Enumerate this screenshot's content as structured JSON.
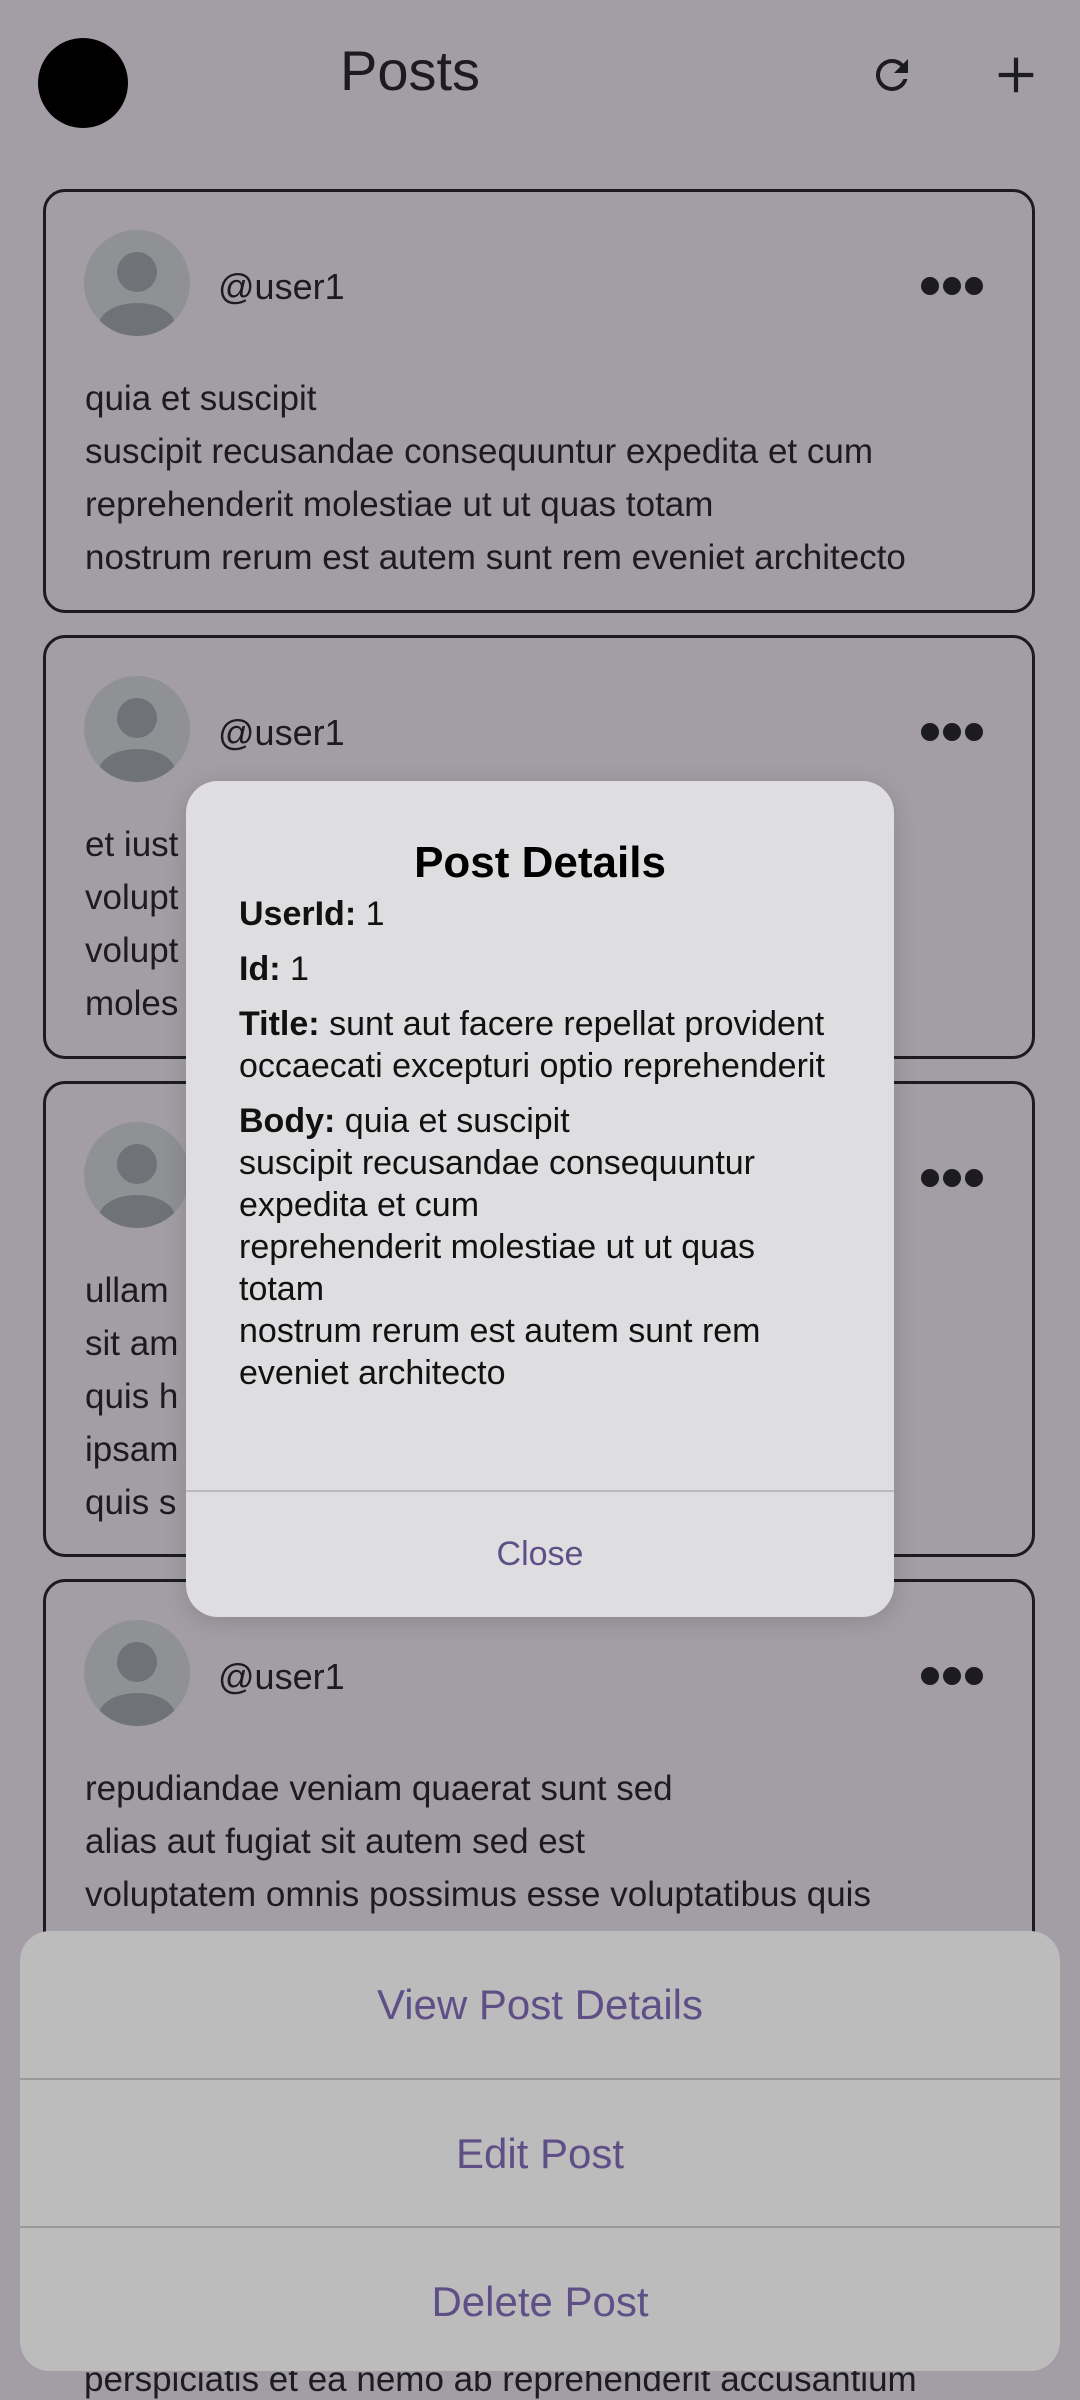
{
  "app_bar": {
    "title": "Posts",
    "icons": {
      "refresh": "refresh-icon",
      "add": "add-icon"
    }
  },
  "posts": [
    {
      "username": "@user1",
      "body": "quia et suscipit\nsuscipit recusandae consequuntur expedita et cum\nreprehenderit molestiae ut ut quas totam\nnostrum rerum est autem sunt rem eveniet architecto"
    },
    {
      "username": "@user1",
      "body": "et iust\nvolupt\nvolupt                                                                   atur\nmoles"
    },
    {
      "username": "",
      "body": "ullam\nsit am                                                                    pa\nquis h                                                                    que\nipsam\nquis s"
    },
    {
      "username": "@user1",
      "body": "repudiandae veniam quaerat sunt sed\nalias aut fugiat sit autem sed est\nvoluptatem omnis possimus esse voluptatibus quis\nest aut tenetur dolor neque"
    }
  ],
  "dialog": {
    "title": "Post Details",
    "userid_label": "UserId:",
    "userid_value": "1",
    "id_label": "Id:",
    "id_value": "1",
    "title_label": "Title:",
    "title_value": "sunt aut facere repellat provident occaecati excepturi optio reprehenderit",
    "body_label": "Body:",
    "body_value": "quia et suscipit\nsuscipit recusandae consequuntur expedita et cum\nreprehenderit molestiae ut ut quas totam\nnostrum rerum est autem sunt rem eveniet architecto",
    "close_label": "Close"
  },
  "bottom_sheet": {
    "view_label": "View Post Details",
    "edit_label": "Edit Post",
    "delete_label": "Delete Post"
  },
  "peek_text": "perspiciatis et ea nemo ab reprehenderit accusantium",
  "colors": {
    "background": "#a39ea5",
    "accent": "#5e5087",
    "dialog": "#dedde0",
    "sheet": "#bdbcbd"
  }
}
